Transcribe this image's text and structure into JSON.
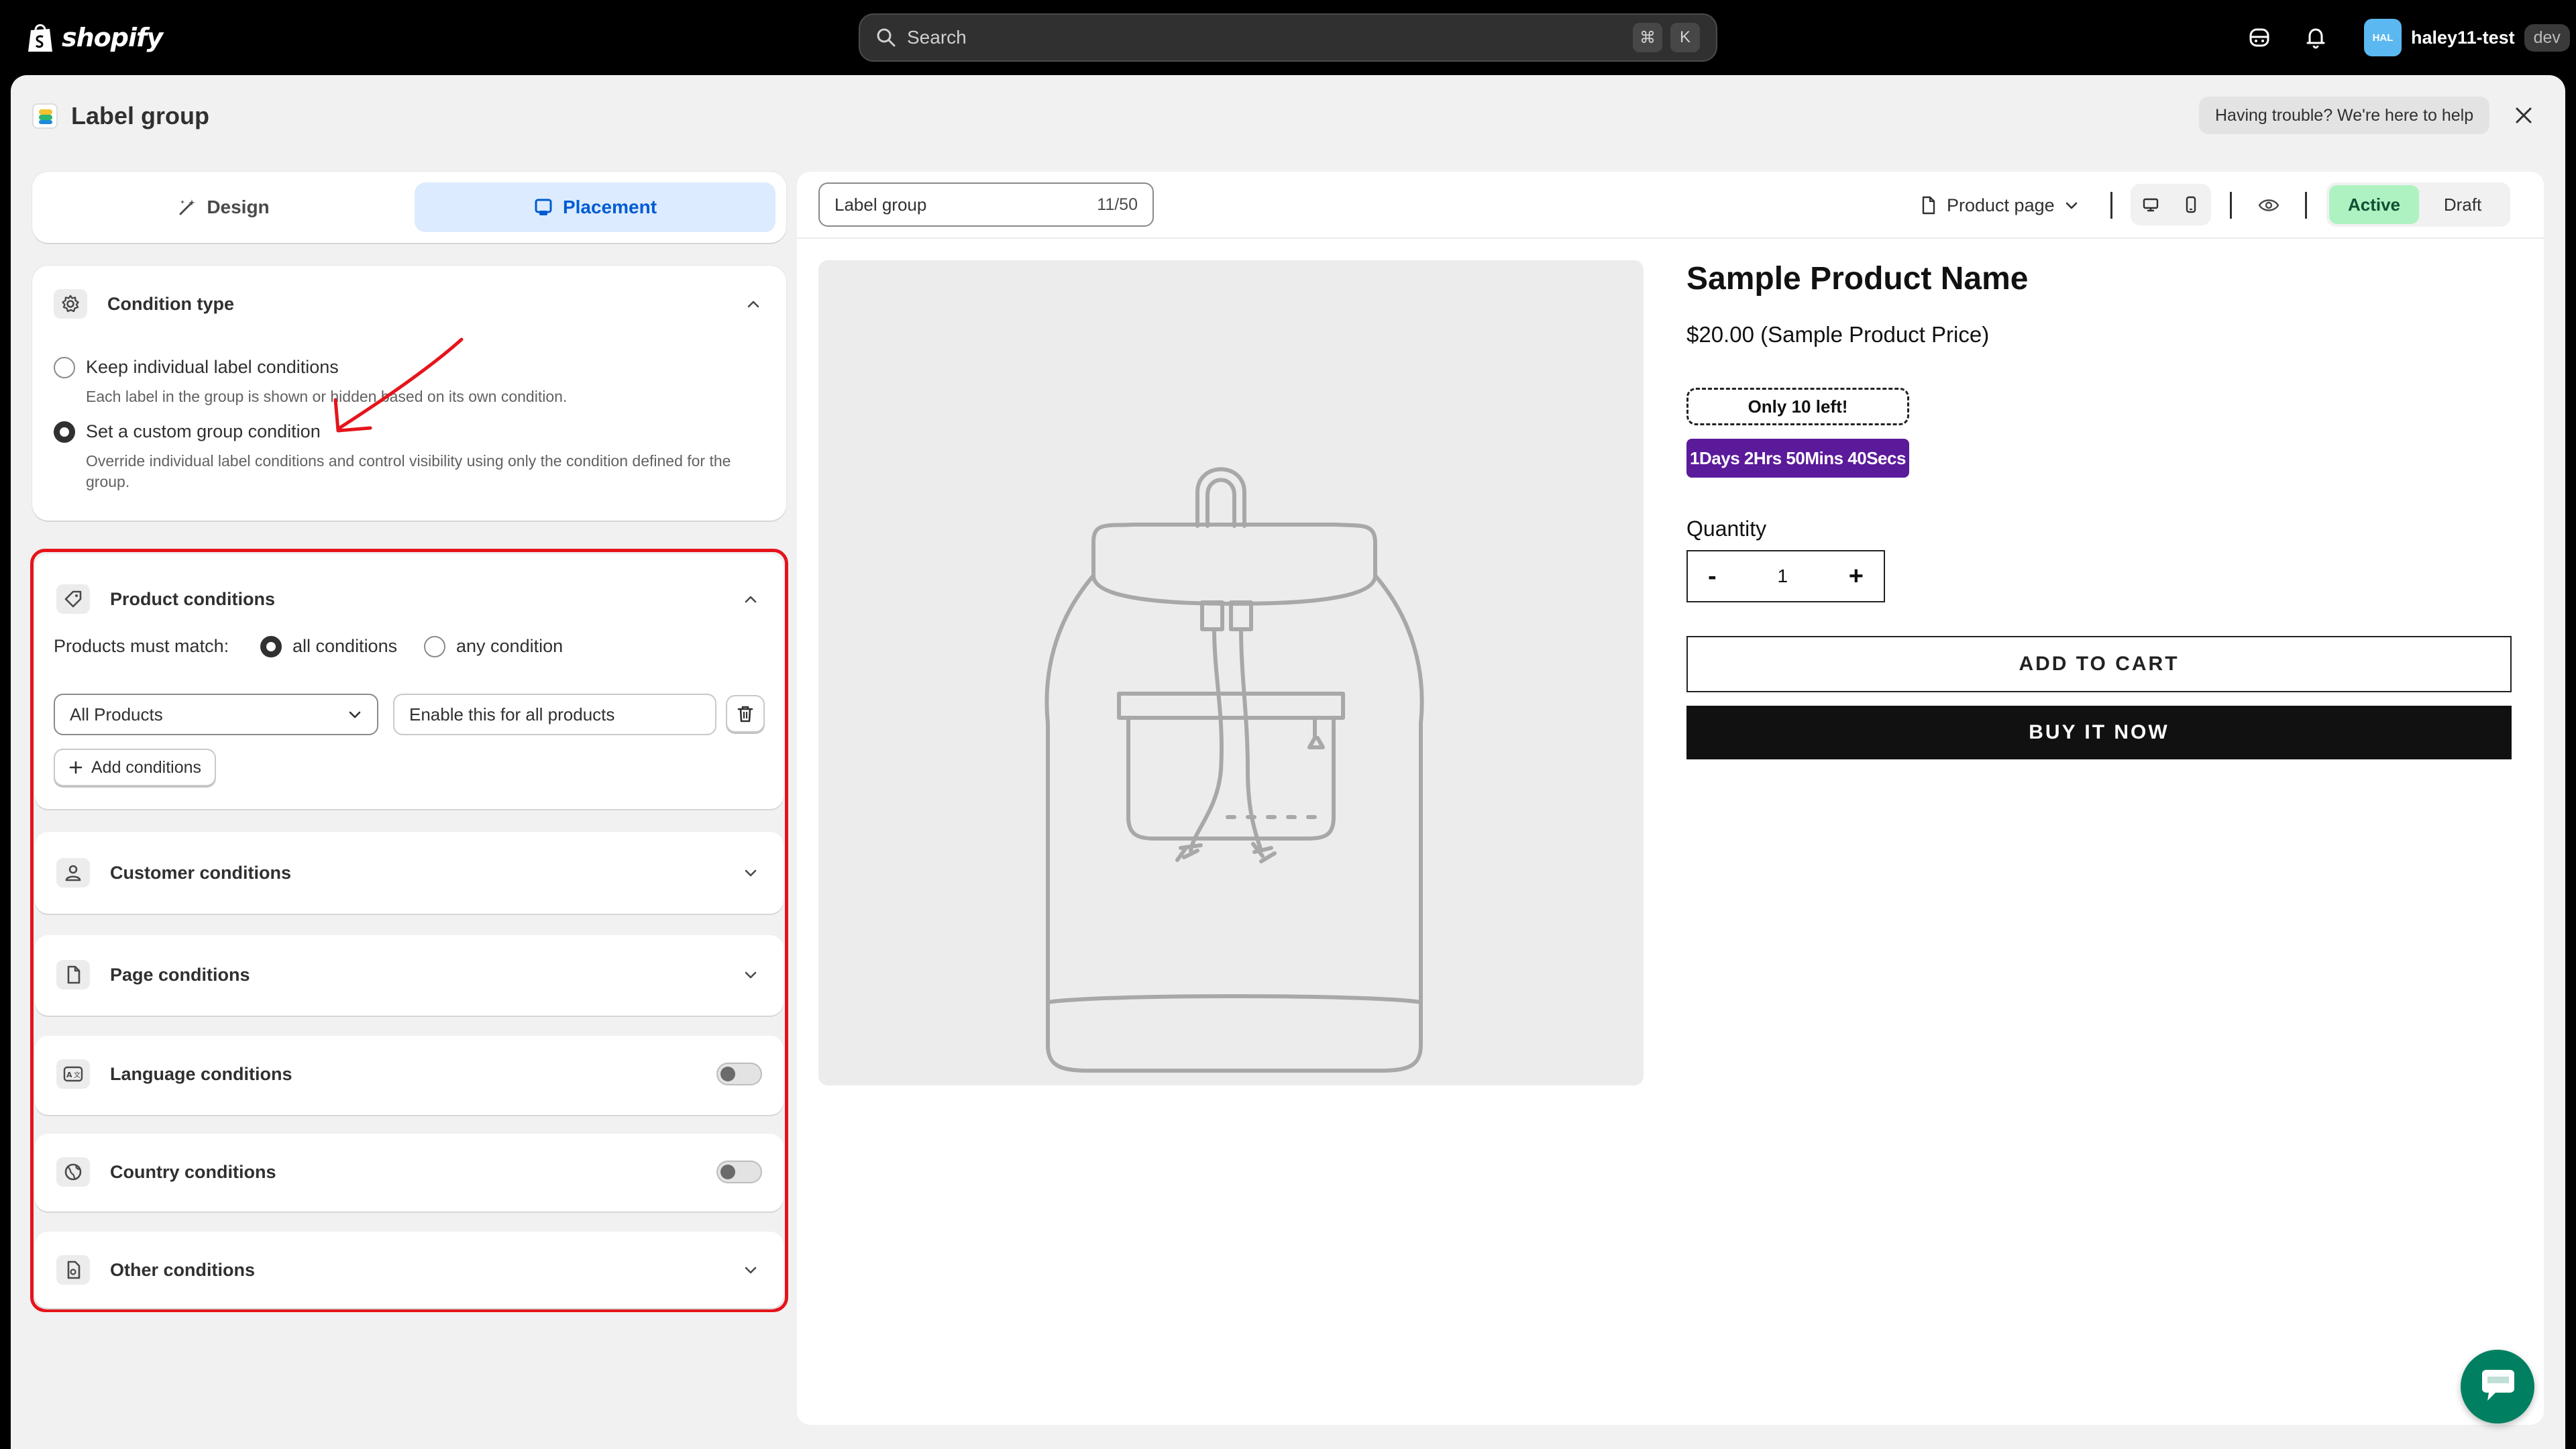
{
  "topbar": {
    "brand": "shopify",
    "search_placeholder": "Search",
    "shortcut_keys": [
      "⌘",
      "K"
    ],
    "user_initials": "HAL",
    "username": "haley11-test",
    "env_badge": "dev"
  },
  "window": {
    "title": "Label group",
    "help_text": "Having trouble? We're here to help"
  },
  "tabs": {
    "design": "Design",
    "placement": "Placement",
    "selected": "Placement"
  },
  "condition_type": {
    "title": "Condition type",
    "options": [
      {
        "label": "Keep individual label conditions",
        "desc": "Each label in the group is shown or hidden based on its own condition.",
        "selected": false
      },
      {
        "label": "Set a custom group condition",
        "desc": "Override individual label conditions and control visibility using only the condition defined for the group.",
        "selected": true
      }
    ]
  },
  "product_conditions": {
    "title": "Product conditions",
    "match_label": "Products must match:",
    "match_all": "all conditions",
    "match_any": "any condition",
    "match_selected": "all conditions",
    "select_value": "All Products",
    "rule_value": "Enable this for all products",
    "add_button": "Add conditions"
  },
  "sections": {
    "customer": "Customer conditions",
    "page": "Page conditions",
    "language": "Language conditions",
    "country": "Country conditions",
    "other": "Other conditions",
    "language_enabled": false,
    "country_enabled": false
  },
  "preview": {
    "group_name": "Label group",
    "char_count": "11/50",
    "page_type": "Product page",
    "status_active": "Active",
    "status_draft": "Draft",
    "status_selected": "Active",
    "product_name": "Sample Product Name",
    "product_price": "$20.00 (Sample Product Price)",
    "badge_stock": "Only 10 left!",
    "badge_timer": "1Days 2Hrs 50Mins 40Secs",
    "quantity_label": "Quantity",
    "quantity_minus": "-",
    "quantity_value": "1",
    "quantity_plus": "+",
    "add_to_cart": "ADD TO CART",
    "buy_now": "BUY IT NOW"
  },
  "colors": {
    "accent_blue": "#005bd3",
    "tab_selected_bg": "#dcebff",
    "active_green_bg": "#aff2c1",
    "timer_badge": "#5b1a9a",
    "highlight_red": "#e5141b",
    "chat_green": "#008060"
  }
}
